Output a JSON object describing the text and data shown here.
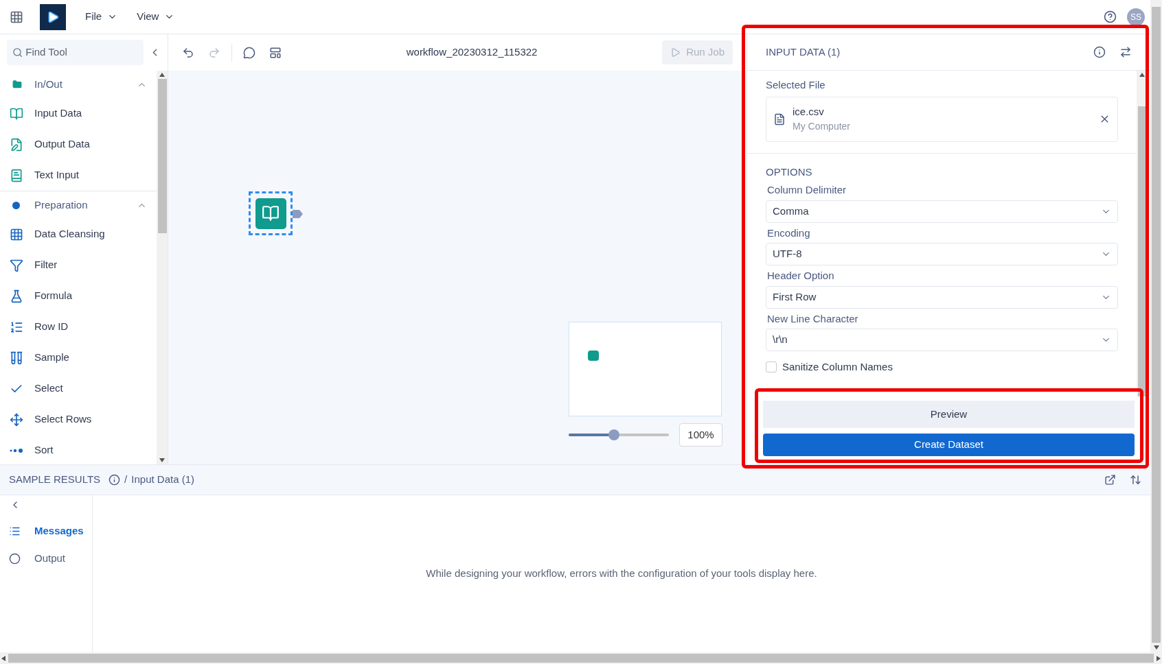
{
  "menu": [
    {
      "label": "File"
    },
    {
      "label": "View"
    }
  ],
  "user": {
    "initials": "SS"
  },
  "sidebar": {
    "search": {
      "placeholder": "Find Tool"
    },
    "groups": [
      {
        "label": "In/Out",
        "expanded": true,
        "color": "#0f9b8e",
        "items": [
          {
            "label": "Input Data"
          },
          {
            "label": "Output Data"
          },
          {
            "label": "Text Input"
          }
        ]
      },
      {
        "label": "Preparation",
        "expanded": true,
        "color": "#1565c0",
        "items": [
          {
            "label": "Data Cleansing"
          },
          {
            "label": "Filter"
          },
          {
            "label": "Formula"
          },
          {
            "label": "Row ID"
          },
          {
            "label": "Sample"
          },
          {
            "label": "Select"
          },
          {
            "label": "Select Rows"
          },
          {
            "label": "Sort"
          }
        ]
      }
    ]
  },
  "toolbar": {
    "title": "workflow_20230312_115322",
    "run_button": {
      "label": "Run Job",
      "disabled": true
    },
    "redo_disabled": true
  },
  "canvas": {
    "node": {
      "selected": true
    },
    "zoom": {
      "level": 0.45,
      "reading": "100%"
    }
  },
  "panel": {
    "title": "INPUT DATA (1)",
    "selected_file_label": "Selected File",
    "file": {
      "name": "ice.csv",
      "source": "My Computer"
    },
    "options_title": "OPTIONS",
    "options": [
      {
        "label": "Column Delimiter",
        "value": "Comma"
      },
      {
        "label": "Encoding",
        "value": "UTF-8"
      },
      {
        "label": "Header Option",
        "value": "First Row"
      },
      {
        "label": "New Line Character",
        "value": "\\r\\n"
      }
    ],
    "checkbox": {
      "label": "Sanitize Column Names",
      "checked": false
    },
    "buttons": [
      {
        "label": "Preview",
        "kind": "secondary"
      },
      {
        "label": "Create Dataset",
        "kind": "primary"
      }
    ]
  },
  "results": {
    "title": "SAMPLE RESULTS",
    "separator": "/",
    "crumb": "Input Data (1)",
    "tabs": [
      {
        "label": "Messages",
        "selected": true
      },
      {
        "label": "Output",
        "selected": false
      }
    ],
    "message": "While designing your workflow, errors with the configuration of your tools display here."
  }
}
